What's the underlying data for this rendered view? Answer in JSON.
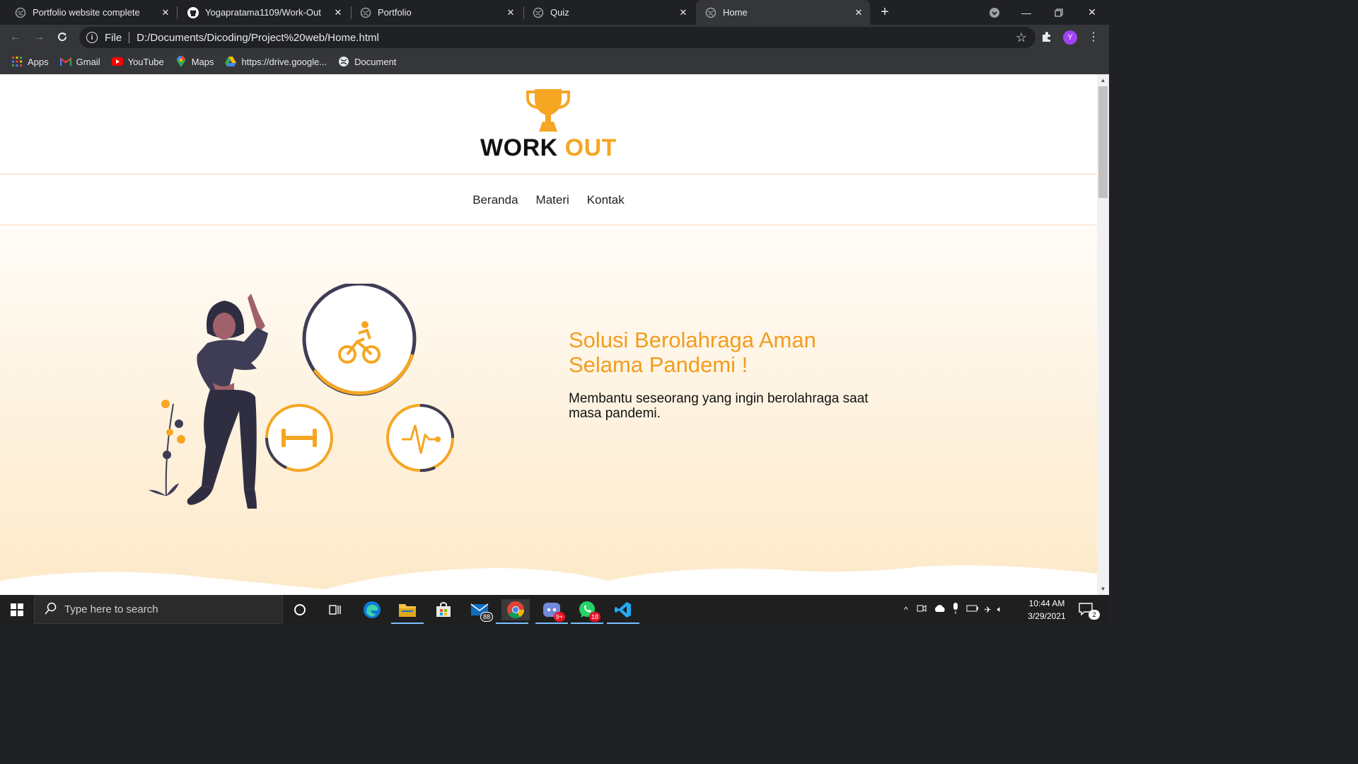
{
  "browser": {
    "tabs": [
      {
        "title": "Portfolio website complete",
        "icon": "globe-icon",
        "active": false
      },
      {
        "title": "Yogapratama1109/Work-Out",
        "icon": "github-icon",
        "active": false
      },
      {
        "title": "Portfolio",
        "icon": "globe-icon",
        "active": false
      },
      {
        "title": "Quiz",
        "icon": "globe-icon",
        "active": false
      },
      {
        "title": "Home",
        "icon": "globe-icon",
        "active": true
      }
    ],
    "address": {
      "scheme_label": "File",
      "url": "D:/Documents/Dicoding/Project%20web/Home.html"
    },
    "profile_initial": "Y",
    "bookmarks": [
      {
        "label": "Apps",
        "icon": "apps-grid-icon"
      },
      {
        "label": "Gmail",
        "icon": "gmail-icon"
      },
      {
        "label": "YouTube",
        "icon": "youtube-icon"
      },
      {
        "label": "Maps",
        "icon": "maps-icon"
      },
      {
        "label": "https://drive.google...",
        "icon": "drive-icon"
      },
      {
        "label": "Document",
        "icon": "globe-icon"
      }
    ]
  },
  "site": {
    "brand": {
      "word1": "WORK",
      "word2": "OUT"
    },
    "nav": [
      "Beranda",
      "Materi",
      "Kontak"
    ],
    "hero": {
      "title": "Solusi Berolahraga Aman Selama Pandemi !",
      "description": "Membantu seseorang yang ingin berolahraga saat masa pandemi."
    },
    "colors": {
      "accent": "#f5a623",
      "dark": "#3f3d56",
      "hero_bg_bottom": "#fde9c8"
    }
  },
  "taskbar": {
    "search_placeholder": "Type here to search",
    "mail_badge": "88",
    "discord_badge": "9+",
    "whatsapp_badge": "18",
    "time": "10:44 AM",
    "date": "3/29/2021",
    "notification_count": "2"
  }
}
